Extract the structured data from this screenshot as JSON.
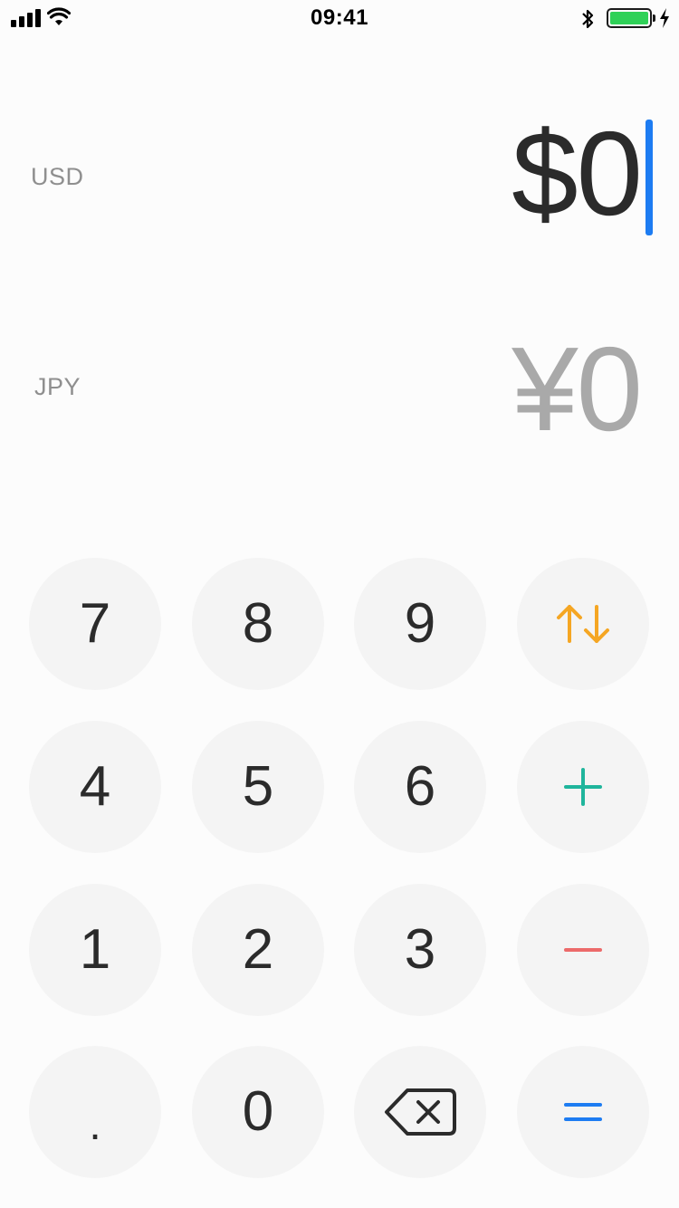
{
  "status_bar": {
    "time": "09:41",
    "signal_icon": "signal-bars-icon",
    "wifi_icon": "wifi-icon",
    "bluetooth_icon": "bluetooth-icon",
    "battery_icon": "battery-full-icon",
    "charging_icon": "charging-bolt-icon",
    "battery_color": "#2fd158"
  },
  "converter": {
    "source": {
      "code": "USD",
      "amount": "$0"
    },
    "target": {
      "code": "JPY",
      "amount": "¥0"
    },
    "cursor_color": "#1d7cf2"
  },
  "keypad": {
    "keys": {
      "k7": "7",
      "k8": "8",
      "k9": "9",
      "k4": "4",
      "k5": "5",
      "k6": "6",
      "k1": "1",
      "k2": "2",
      "k3": "3",
      "dot": ".",
      "k0": "0"
    },
    "operators": {
      "swap": {
        "icon": "swap-arrows-icon",
        "color": "#f5a623"
      },
      "plus": {
        "icon": "plus-icon",
        "color": "#1fb59c"
      },
      "minus": {
        "icon": "minus-icon",
        "color": "#ec6a6a"
      },
      "equals": {
        "icon": "equals-icon",
        "color": "#1d7cf2"
      },
      "backspace": {
        "icon": "backspace-icon",
        "color": "#2b2b2b"
      }
    },
    "key_background": "#f4f4f4"
  }
}
